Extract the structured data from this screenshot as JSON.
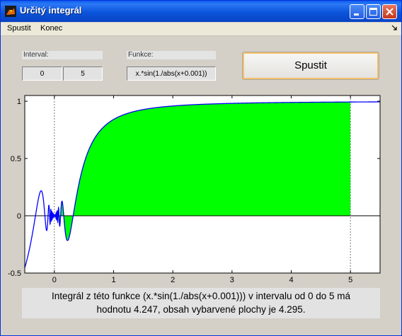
{
  "window": {
    "title": "Určitý integrál",
    "icon": "matlab-figure-icon"
  },
  "menubar": {
    "items": [
      "Spustit",
      "Konec"
    ],
    "dock_icon": "dock-arrow-icon"
  },
  "controls": {
    "interval_label": "Interval:",
    "interval_from": "0",
    "interval_to": "5",
    "function_label": "Funkce:",
    "function_value": "x.*sin(1./abs(x+0.001))",
    "run_button_label": "Spustit"
  },
  "chart_data": {
    "type": "area",
    "function": "x.*sin(1./abs(x+0.001))",
    "shaded_interval": [
      0,
      5
    ],
    "xlim": [
      -0.5,
      5.5
    ],
    "ylim": [
      -0.5,
      1.05
    ],
    "xticks": [
      0,
      1,
      2,
      3,
      4,
      5
    ],
    "yticks": [
      -0.5,
      0,
      0.5,
      1
    ],
    "xtick_labels": [
      "0",
      "1",
      "2",
      "3",
      "4",
      "5"
    ],
    "ytick_labels": [
      "-0.5",
      "0",
      "0.5",
      "1"
    ],
    "line_color": "#0000ff",
    "fill_color": "#00ff00",
    "grid": false
  },
  "result": {
    "line1": "Integrál z této funkce (x.*sin(1./abs(x+0.001))) v intervalu od 0 do 5 má",
    "line2": "hodnotu 4.247, obsah vybarvené plochy je 4.295."
  }
}
